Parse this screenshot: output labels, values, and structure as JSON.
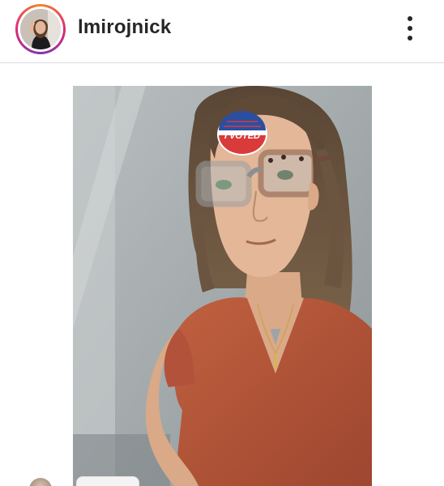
{
  "post_header": {
    "username": "lmirojnick",
    "avatar_icon": "profile-photo",
    "more_icon": "three-dots-vertical-icon"
  },
  "post_media": {
    "sticker_text": "I VOTED",
    "story_ring_colors": [
      "#f58529",
      "#dd2a7b",
      "#8134af"
    ]
  },
  "colors": {
    "text": "#262626",
    "divider": "#dbdbdb",
    "shirt": "#b5533a",
    "frames": "#8c8f91",
    "sticker_blue": "#2a4fa0",
    "sticker_red": "#d93a3a"
  }
}
